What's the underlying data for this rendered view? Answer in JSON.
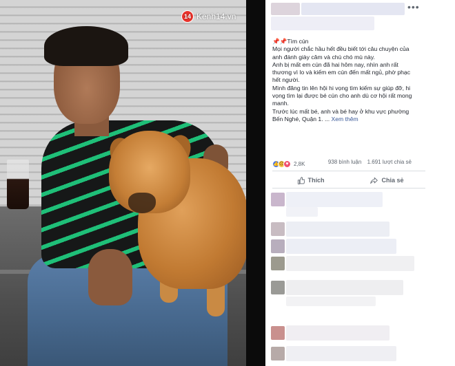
{
  "watermark": {
    "logo": "14",
    "text": "Kenh14.vn"
  },
  "post": {
    "heading_emoji": "📌📌",
    "heading": "Tìm cún",
    "paragraphs": [
      "Mọi người chắc hầu hết đều biết tới câu chuyện của anh đánh giày câm và chú chó mù này.",
      "Anh bị mất em cún đã hai hôm nay, nhìn anh rất thương vì lo và kiếm em cún đến mất ngủ, phờ phạc hết người.",
      "Mình đăng tin lên hội hi vọng tìm kiếm sự giúp đỡ, hi vọng tìm lại được bé cún cho anh dù cơ hội rất mong manh.",
      "Trước lúc mất bé, anh và bé hay ở khu vực phường Bến Nghé, Quận 1. ..."
    ],
    "see_more": "Xem thêm"
  },
  "reactions": {
    "count": "2,8K",
    "comments": "938 bình luận",
    "shares": "1.691 lượt chia sẻ",
    "icons": [
      "like-icon",
      "sad-icon",
      "love-icon"
    ]
  },
  "actions": {
    "like": "Thích",
    "share": "Chia sẻ"
  },
  "more_menu": "•••",
  "colors": {
    "link": "#385898",
    "like": "#4a76e8",
    "love": "#f0506e",
    "sad": "#f6c448",
    "shirt_stripe": "#1fbf78",
    "watermark_logo": "#e8322b"
  }
}
